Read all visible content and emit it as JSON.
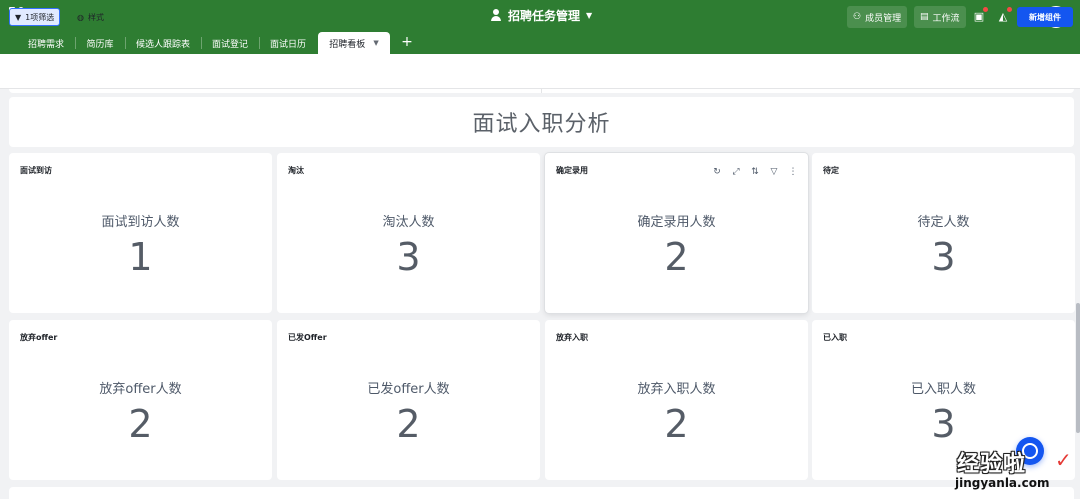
{
  "header": {
    "title": "招聘任务管理",
    "buttons": {
      "members": "成员管理",
      "workflow": "工作流"
    },
    "help": "?"
  },
  "tabs": [
    {
      "label": "招聘需求"
    },
    {
      "label": "简历库"
    },
    {
      "label": "候选人跟踪表"
    },
    {
      "label": "面试登记"
    },
    {
      "label": "面试日历"
    },
    {
      "label": "招聘看板"
    }
  ],
  "toolbar": {
    "filter": "1项筛选",
    "style": "样式",
    "new_component": "新增组件"
  },
  "dashboard": {
    "title": "面试入职分析",
    "cards": [
      {
        "title": "面试到访",
        "label": "面试到访人数",
        "value": "1"
      },
      {
        "title": "淘汰",
        "label": "淘汰人数",
        "value": "3"
      },
      {
        "title": "确定录用",
        "label": "确定录用人数",
        "value": "2"
      },
      {
        "title": "待定",
        "label": "待定人数",
        "value": "3"
      },
      {
        "title": "放弃offer",
        "label": "放弃offer人数",
        "value": "2"
      },
      {
        "title": "已发Offer",
        "label": "已发offer人数",
        "value": "2"
      },
      {
        "title": "放弃入职",
        "label": "放弃入职人数",
        "value": "2"
      },
      {
        "title": "已入职",
        "label": "已入职人数",
        "value": "3"
      }
    ]
  },
  "watermark": {
    "line1": "经验啦",
    "line2": "jingyanla.com"
  },
  "colors": {
    "topbar": "#2e7d32",
    "primary": "#1456f0"
  }
}
